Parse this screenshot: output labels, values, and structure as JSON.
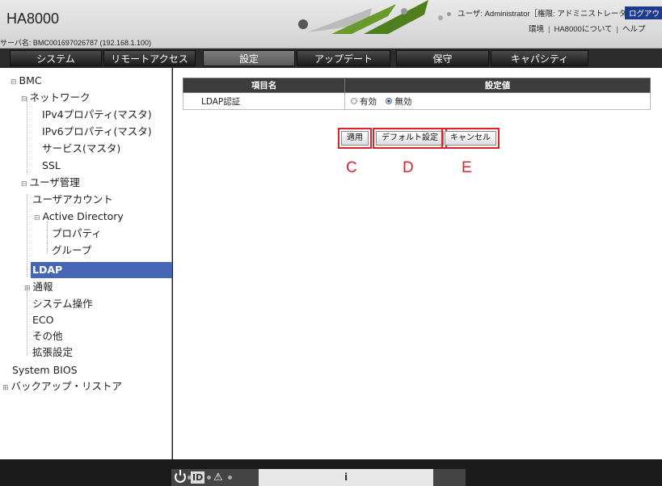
{
  "header": {
    "app_title": "HA8000",
    "server_label": "サーバ名: BMC001697026787 (192.168.1.100)",
    "user_info": "ユーザ: Administrator［権限: アドミニストレータ］",
    "logout_label": "ログアウト",
    "env_link": "環境",
    "about_link": "HA8000について",
    "help_link": "ヘルプ"
  },
  "tabs": [
    {
      "label": "システム"
    },
    {
      "label": "リモートアクセス"
    },
    {
      "label": "設定"
    },
    {
      "label": "アップデート"
    },
    {
      "label": "保守"
    },
    {
      "label": "キャパシティ"
    }
  ],
  "active_tab": "設定",
  "sidebar": {
    "items": [
      {
        "label": "BMC",
        "toggle": "⊟"
      },
      {
        "label": "ネットワーク",
        "toggle": "⊟"
      },
      {
        "label": "IPv4プロパティ(マスタ)"
      },
      {
        "label": "IPv6プロパティ(マスタ)"
      },
      {
        "label": "サービス(マスタ)"
      },
      {
        "label": "SSL"
      },
      {
        "label": "ユーザ管理",
        "toggle": "⊟"
      },
      {
        "label": "ユーザアカウント"
      },
      {
        "label": "Active Directory",
        "toggle": "⊟"
      },
      {
        "label": "プロパティ"
      },
      {
        "label": "グループ"
      },
      {
        "label": "LDAP"
      },
      {
        "label": "通報",
        "toggle": "⊞"
      },
      {
        "label": "システム操作"
      },
      {
        "label": "ECO"
      },
      {
        "label": "その他"
      },
      {
        "label": "拡張設定"
      },
      {
        "label": "System BIOS"
      },
      {
        "label": "バックアップ・リストア",
        "toggle": "⊞"
      }
    ],
    "active_item": "LDAP"
  },
  "table": {
    "col_item": "項目名",
    "col_value": "設定値",
    "rows": [
      {
        "item": "LDAP認証",
        "option_on": "有効",
        "option_off": "無効",
        "selected": "無効"
      }
    ]
  },
  "buttons": {
    "apply": "適用",
    "default": "デフォルト設定",
    "cancel": "キャンセル"
  },
  "markers": {
    "c": "C",
    "d": "D",
    "e": "E"
  },
  "footer": {
    "id_label": "ID",
    "status_indicator": "i"
  },
  "colors": {
    "active_nav": "#4666b4",
    "tab_bar": "#2b2b2b",
    "highlight_box": "#e0202a",
    "logout_bg": "#1f3b8f"
  }
}
